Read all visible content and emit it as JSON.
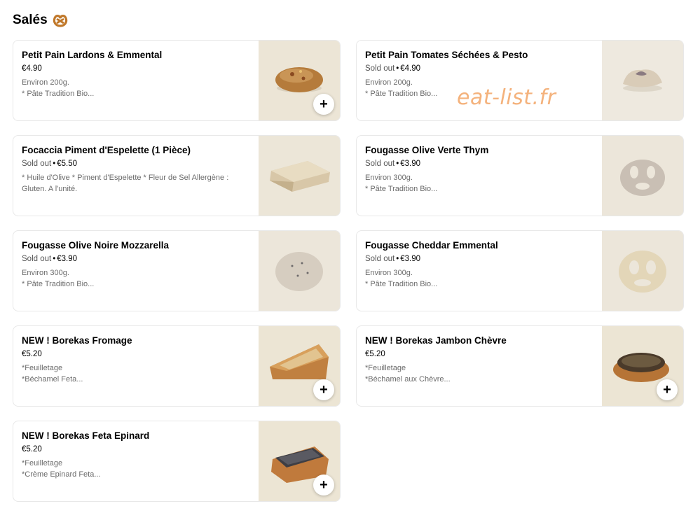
{
  "section": {
    "title": "Salés",
    "icon": "pretzel-icon"
  },
  "watermark": "eat-list.fr",
  "items": [
    {
      "title": "Petit Pain Lardons & Emmental",
      "sold_out": "",
      "price": "€4.90",
      "desc": [
        "Environ 200g.",
        "* Pâte Tradition Bio..."
      ],
      "add": "+",
      "photo": "bun-lardons"
    },
    {
      "title": "Petit Pain Tomates Séchées & Pesto",
      "sold_out": "Sold out",
      "price": "€4.90",
      "desc": [
        "Environ 200g.",
        "* Pâte Tradition Bio..."
      ],
      "add": "",
      "photo": "bun-tomato"
    },
    {
      "title": "Focaccia Piment d'Espelette (1 Pièce)",
      "sold_out": "Sold out",
      "price": "€5.50",
      "desc": [
        "* Huile d'Olive * Piment d'Espelette * Fleur de Sel Allergène :",
        "Gluten. A l'unité."
      ],
      "add": "",
      "photo": "focaccia"
    },
    {
      "title": "Fougasse Olive Verte Thym",
      "sold_out": "Sold out",
      "price": "€3.90",
      "desc": [
        "Environ 300g.",
        "* Pâte Tradition Bio..."
      ],
      "add": "",
      "photo": "fougasse-green"
    },
    {
      "title": "Fougasse Olive Noire Mozzarella",
      "sold_out": "Sold out",
      "price": "€3.90",
      "desc": [
        "Environ 300g.",
        "* Pâte Tradition Bio..."
      ],
      "add": "",
      "photo": "fougasse-black"
    },
    {
      "title": "Fougasse Cheddar Emmental",
      "sold_out": "Sold out",
      "price": "€3.90",
      "desc": [
        "Environ 300g.",
        "* Pâte Tradition Bio..."
      ],
      "add": "",
      "photo": "fougasse-cheddar"
    },
    {
      "title": "NEW ! Borekas Fromage",
      "sold_out": "",
      "price": "€5.20",
      "desc": [
        "*Feuilletage",
        "*Béchamel Feta..."
      ],
      "add": "+",
      "photo": "borekas-sesame"
    },
    {
      "title": "NEW ! Borekas Jambon Chèvre",
      "sold_out": "",
      "price": "€5.20",
      "desc": [
        "*Feuilletage",
        "*Béchamel aux Chèvre..."
      ],
      "add": "+",
      "photo": "borekas-dark"
    },
    {
      "title": "NEW ! Borekas Feta Epinard",
      "sold_out": "",
      "price": "€5.20",
      "desc": [
        "*Feuilletage",
        "*Crème Epinard Feta..."
      ],
      "add": "+",
      "photo": "borekas-poppy"
    }
  ]
}
